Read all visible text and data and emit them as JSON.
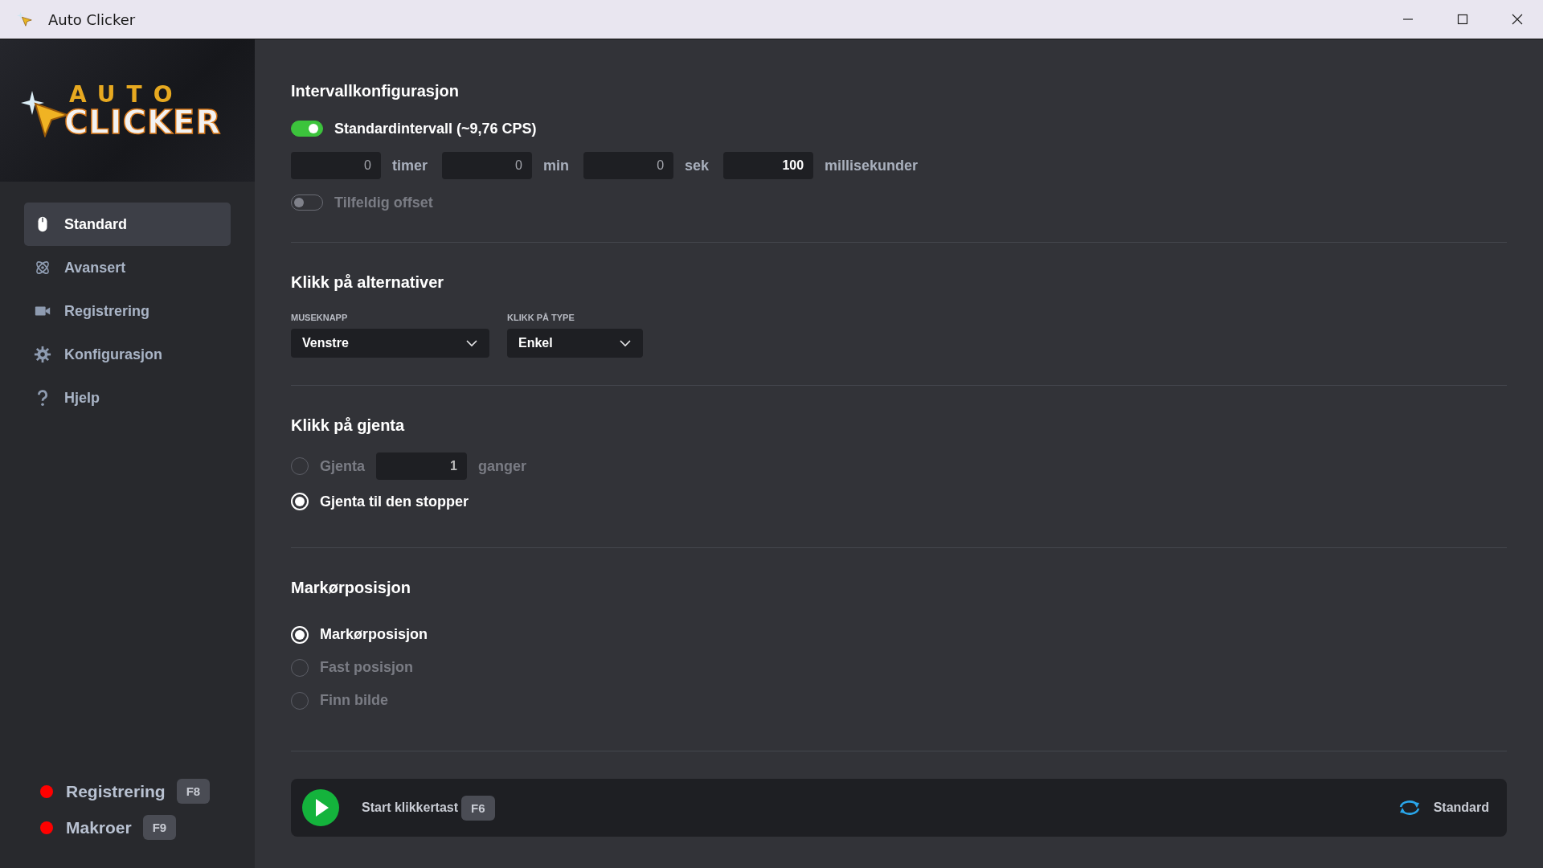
{
  "window": {
    "title": "Auto Clicker"
  },
  "logo": {
    "line1": "AUTO",
    "line2": "CLICKER"
  },
  "sidebar": {
    "items": [
      {
        "label": "Standard",
        "selected": true
      },
      {
        "label": "Avansert",
        "selected": false
      },
      {
        "label": "Registrering",
        "selected": false
      },
      {
        "label": "Konfigurasjon",
        "selected": false
      },
      {
        "label": "Hjelp",
        "selected": false
      }
    ],
    "hotkeys": [
      {
        "label": "Registrering",
        "key": "F8"
      },
      {
        "label": "Makroer",
        "key": "F9"
      }
    ]
  },
  "interval": {
    "title": "Intervallkonfigurasjon",
    "standard_toggle": {
      "label": "Standardintervall (~9,76 CPS)",
      "on": true
    },
    "fields": [
      {
        "value": "0",
        "unit": "timer"
      },
      {
        "value": "0",
        "unit": "min"
      },
      {
        "value": "0",
        "unit": "sek"
      },
      {
        "value": "100",
        "unit": "millisekunder"
      }
    ],
    "random_toggle": {
      "label": "Tilfeldig offset",
      "on": false
    }
  },
  "click_options": {
    "title": "Klikk på alternativer",
    "dropdowns": [
      {
        "label": "MUSEKNAPP",
        "value": "Venstre"
      },
      {
        "label": "KLIKK PÅ TYPE",
        "value": "Enkel"
      }
    ]
  },
  "repeat": {
    "title": "Klikk på gjenta",
    "options": [
      {
        "label": "Gjenta",
        "selected": false,
        "count": "1",
        "suffix": "ganger"
      },
      {
        "label": "Gjenta til den stopper",
        "selected": true
      }
    ]
  },
  "cursor": {
    "title": "Markørposisjon",
    "options": [
      {
        "label": "Markørposisjon",
        "selected": true
      },
      {
        "label": "Fast posisjon",
        "selected": false
      },
      {
        "label": "Finn bilde",
        "selected": false
      }
    ]
  },
  "bottom_bar": {
    "start_label": "Start klikkertast",
    "start_key": "F6",
    "reset_label": "Standard"
  }
}
